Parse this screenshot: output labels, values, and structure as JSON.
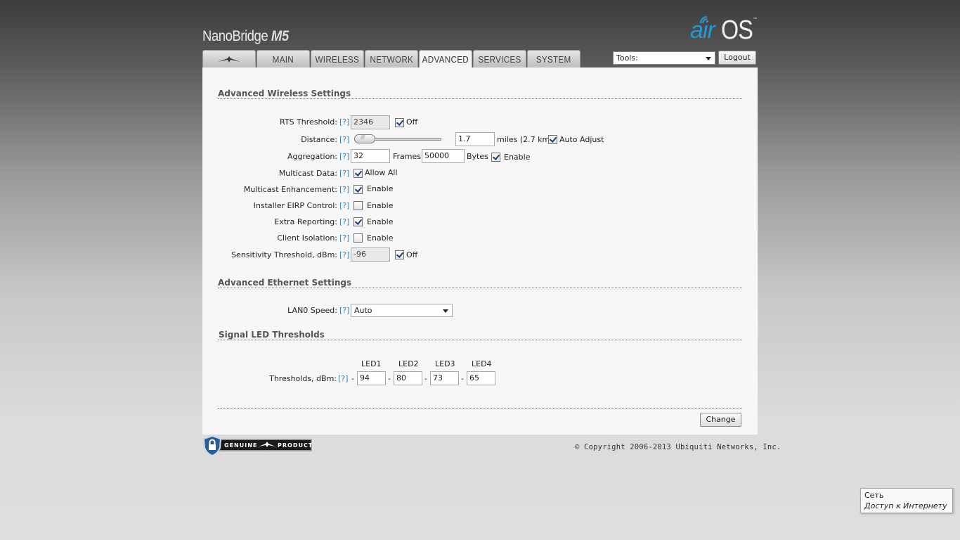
{
  "header": {
    "product_name": "NanoBridge",
    "product_model": "M5",
    "logo_air": "air",
    "logo_os": "OS",
    "logo_tm": "™"
  },
  "tabs": [
    {
      "label": "",
      "icon": "ubiquiti-logo-icon"
    },
    {
      "label": "MAIN"
    },
    {
      "label": "WIRELESS"
    },
    {
      "label": "NETWORK"
    },
    {
      "label": "ADVANCED",
      "active": true
    },
    {
      "label": "SERVICES"
    },
    {
      "label": "SYSTEM"
    }
  ],
  "tools": {
    "selected": "Tools:"
  },
  "logout_label": "Logout",
  "help_label": "[?]",
  "wireless": {
    "title": "Advanced Wireless Settings",
    "rts": {
      "label": "RTS Threshold:",
      "value": "2346",
      "off_checked": true,
      "off_label": "Off"
    },
    "distance": {
      "label": "Distance:",
      "value": "1.7",
      "unit": "miles (2.7 km)",
      "auto_checked": true,
      "auto_label": "Auto Adjust",
      "slider_level": 0.05
    },
    "aggregation": {
      "label": "Aggregation:",
      "frames_value": "32",
      "frames_unit": "Frames",
      "bytes_value": "50000",
      "bytes_unit": "Bytes",
      "enable_checked": true,
      "enable_label": "Enable"
    },
    "multicast_data": {
      "label": "Multicast Data:",
      "checked": true,
      "option_label": "Allow All"
    },
    "multicast_enh": {
      "label": "Multicast Enhancement:",
      "checked": true,
      "option_label": "Enable"
    },
    "eirp": {
      "label": "Installer EIRP Control:",
      "checked": false,
      "option_label": "Enable"
    },
    "extra": {
      "label": "Extra Reporting:",
      "checked": true,
      "option_label": "Enable"
    },
    "isolation": {
      "label": "Client Isolation:",
      "checked": false,
      "option_label": "Enable"
    },
    "sensitivity": {
      "label": "Sensitivity Threshold, dBm:",
      "value": "-96",
      "off_checked": true,
      "off_label": "Off"
    }
  },
  "ethernet": {
    "title": "Advanced Ethernet Settings",
    "lan_label": "LAN0 Speed:",
    "lan_value": "Auto"
  },
  "led": {
    "title": "Signal LED Thresholds",
    "thresholds_label": "Thresholds, dBm:",
    "dash": "-",
    "headers": [
      "LED1",
      "LED2",
      "LED3",
      "LED4"
    ],
    "values": [
      "94",
      "80",
      "73",
      "65"
    ]
  },
  "change_label": "Change",
  "footer": {
    "genuine_left": "GENUINE",
    "genuine_right": "PRODUCT",
    "copyright": "© Copyright 2006-2013 Ubiquiti Networks, Inc."
  },
  "tray": {
    "title": "Сеть",
    "status": "Доступ к Интернету"
  }
}
